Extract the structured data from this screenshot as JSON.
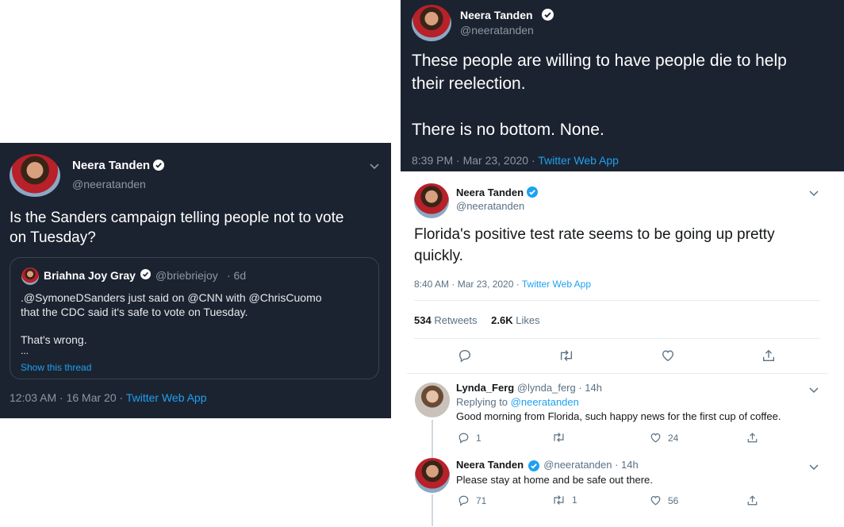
{
  "left_tweet": {
    "author": "Neera Tanden",
    "handle": "@neeratanden",
    "text": "Is the Sanders campaign telling people not to vote on Tuesday?",
    "quote": {
      "author": "Briahna Joy Gray",
      "handle": "@briebriejoy",
      "age": "· 6d",
      "line1": ".@SymoneDSanders just said on @CNN with @ChrisCuomo",
      "line2": "that the CDC said it's safe to vote on Tuesday.",
      "line3": "That's wrong.",
      "ellipsis": "...",
      "show_thread": "Show this thread"
    },
    "timestamp": "12:03 AM · 16 Mar 20 · ",
    "source": "Twitter Web App"
  },
  "top_tweet": {
    "author": "Neera Tanden",
    "handle": "@neeratanden",
    "line1": "These people are willing to have people die to help",
    "line2": "their reelection.",
    "line3": "There is no bottom. None.",
    "timestamp": "8:39 PM · Mar 23, 2020 · ",
    "source": "Twitter Web App"
  },
  "main_tweet": {
    "author": "Neera Tanden",
    "handle": "@neeratanden",
    "line1": "Florida's positive test rate seems to be going up pretty",
    "line2": "quickly.",
    "timestamp": "8:40 AM · Mar 23, 2020 · ",
    "source": "Twitter Web App",
    "retweets": "534",
    "retweets_label": "Retweets",
    "likes": "2.6K",
    "likes_label": "Likes"
  },
  "reply1": {
    "author": "Lynda_Ferg",
    "handle": "@lynda_ferg",
    "age": "· 14h",
    "replying_prefix": "Replying to ",
    "replying_to": "@neeratanden",
    "text": "Good morning from Florida, such happy news for the first cup of coffee.",
    "replies": "1",
    "retweets": "",
    "likes": "24"
  },
  "reply2": {
    "author": "Neera Tanden",
    "handle": "@neeratanden",
    "age": "· 14h",
    "text": "Please stay at home and be safe out there.",
    "replies": "71",
    "retweets": "1",
    "likes": "56"
  },
  "colors": {
    "dark_bg": "#1c2330",
    "link": "#1da1f2",
    "verified": "#1da1f2"
  }
}
